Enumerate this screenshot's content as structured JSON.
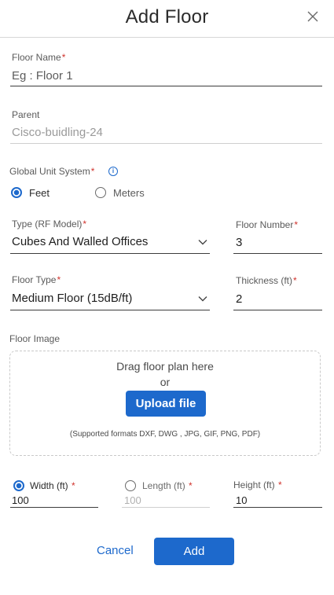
{
  "dialog": {
    "title": "Add Floor",
    "close_icon": "close-icon"
  },
  "floor_name": {
    "label": "Floor Name",
    "required_mark": "*",
    "value": "Eg : Floor 1"
  },
  "parent": {
    "label": "Parent",
    "value": "Cisco-buidling-24"
  },
  "unit_system": {
    "label": "Global Unit System",
    "required_mark": "*",
    "info_icon": "info-icon",
    "options": [
      {
        "label": "Feet",
        "checked": true
      },
      {
        "label": "Meters",
        "checked": false
      }
    ]
  },
  "rf_model": {
    "label": "Type (RF Model)",
    "required_mark": "*",
    "value": "Cubes And Walled Offices"
  },
  "floor_number": {
    "label": "Floor Number",
    "required_mark": "*",
    "value": "3"
  },
  "floor_type": {
    "label": "Floor Type",
    "required_mark": "*",
    "value": "Medium Floor (15dB/ft)"
  },
  "thickness": {
    "label": "Thickness (ft)",
    "required_mark": "*",
    "value": "2"
  },
  "floor_image": {
    "label": "Floor Image",
    "drag_text": "Drag floor plan here",
    "or_text": "or",
    "upload_label": "Upload file",
    "formats_text": "(Supported formats DXF, DWG , JPG, GIF, PNG, PDF)"
  },
  "dimensions": {
    "width": {
      "label": "Width (ft)",
      "required_mark": "*",
      "value": "100",
      "checked": true
    },
    "length": {
      "label": "Length (ft)",
      "required_mark": "*",
      "value": "100",
      "checked": false
    },
    "height": {
      "label": "Height (ft)",
      "required_mark": "*",
      "value": "10"
    }
  },
  "actions": {
    "cancel_label": "Cancel",
    "add_label": "Add"
  },
  "colors": {
    "accent": "#1d69cc",
    "required": "#d0332d"
  }
}
